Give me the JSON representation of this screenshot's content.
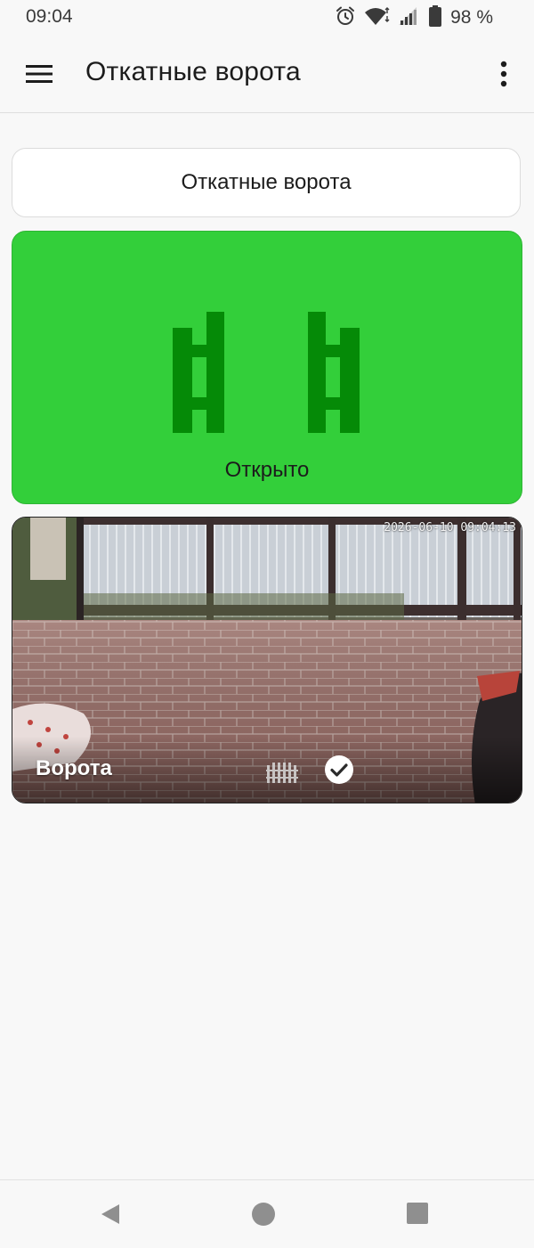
{
  "status_bar": {
    "time": "09:04",
    "battery": "98 %",
    "icons": [
      "alarm-icon",
      "wifi-icon",
      "signal-icon",
      "battery-icon"
    ]
  },
  "app_bar": {
    "title": "Откатные ворота",
    "icons": [
      "menu-icon",
      "more-vert-icon"
    ]
  },
  "device": {
    "name": "Откатные ворота",
    "status_text": "Открыто",
    "status_color": "#33cf3a",
    "icon_color": "#058a07",
    "icon": "gate-open-icon"
  },
  "camera": {
    "timestamp": "2026-06-10 09:04:13",
    "label": "Ворота",
    "icons": [
      "fence-icon",
      "check-circle-icon"
    ]
  },
  "nav_bar": {
    "icons": [
      "back-icon",
      "home-icon",
      "recents-icon"
    ]
  }
}
